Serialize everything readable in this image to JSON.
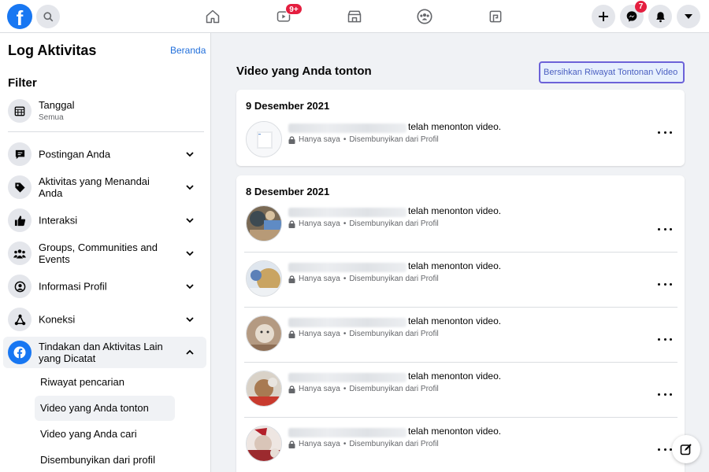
{
  "topbar": {
    "logo": "f",
    "icons": {
      "search": "search-icon",
      "home": "home-icon",
      "watch": "watch-icon",
      "marketplace": "marketplace-icon",
      "groups": "groups-icon",
      "gaming": "gaming-icon",
      "create": "plus-icon",
      "messenger": "messenger-icon",
      "notifications": "bell-icon",
      "account": "caret-down-icon"
    },
    "watch_badge": "9+",
    "messenger_badge": "7"
  },
  "sidebar": {
    "title": "Log Aktivitas",
    "home_link": "Beranda",
    "filter_heading": "Filter",
    "date_filter": {
      "label": "Tanggal",
      "value": "Semua"
    },
    "categories": [
      {
        "label": "Postingan Anda",
        "icon": "comment-icon",
        "expanded": false
      },
      {
        "label": "Aktivitas yang Menandai Anda",
        "icon": "tag-icon",
        "expanded": false
      },
      {
        "label": "Interaksi",
        "icon": "thumbs-up-icon",
        "expanded": false
      },
      {
        "label": "Groups, Communities and Events",
        "icon": "people-icon",
        "expanded": false
      },
      {
        "label": "Informasi Profil",
        "icon": "profile-icon",
        "expanded": false
      },
      {
        "label": "Koneksi",
        "icon": "connections-icon",
        "expanded": false
      },
      {
        "label": "Tindakan dan Aktivitas Lain yang Dicatat",
        "icon": "facebook-icon",
        "expanded": true
      }
    ],
    "subitems": [
      {
        "label": "Riwayat pencarian",
        "selected": false
      },
      {
        "label": "Video yang Anda tonton",
        "selected": true
      },
      {
        "label": "Video yang Anda cari",
        "selected": false
      },
      {
        "label": "Disembunyikan dari profil",
        "selected": false
      }
    ]
  },
  "main": {
    "title": "Video yang Anda tonton",
    "clear_button": "Bersihkan Riwayat Tontonan Video",
    "groups": [
      {
        "date": "9 Desember 2021",
        "entries": [
          {
            "action": "telah menonton",
            "object": "video.",
            "privacy": "Hanya saya",
            "visibility": "Disembunyikan dari Profil",
            "thumb": "video-thumbnail"
          }
        ]
      },
      {
        "date": "8 Desember 2021",
        "entries": [
          {
            "action": "telah menonton",
            "object": "video.",
            "privacy": "Hanya saya",
            "visibility": "Disembunyikan dari Profil",
            "thumb": "video-thumbnail"
          },
          {
            "action": "telah menonton",
            "object": "video.",
            "privacy": "Hanya saya",
            "visibility": "Disembunyikan dari Profil",
            "thumb": "video-thumbnail"
          },
          {
            "action": "telah menonton",
            "object": "video.",
            "privacy": "Hanya saya",
            "visibility": "Disembunyikan dari Profil",
            "thumb": "video-thumbnail"
          },
          {
            "action": "telah menonton",
            "object": "video.",
            "privacy": "Hanya saya",
            "visibility": "Disembunyikan dari Profil",
            "thumb": "video-thumbnail"
          },
          {
            "action": "telah menonton",
            "object": "video.",
            "privacy": "Hanya saya",
            "visibility": "Disembunyikan dari Profil",
            "thumb": "video-thumbnail"
          }
        ]
      }
    ]
  },
  "colors": {
    "brand": "#1877f2",
    "badge": "#e41e3f",
    "link": "#216fdb",
    "button_border": "#6c62d8"
  }
}
